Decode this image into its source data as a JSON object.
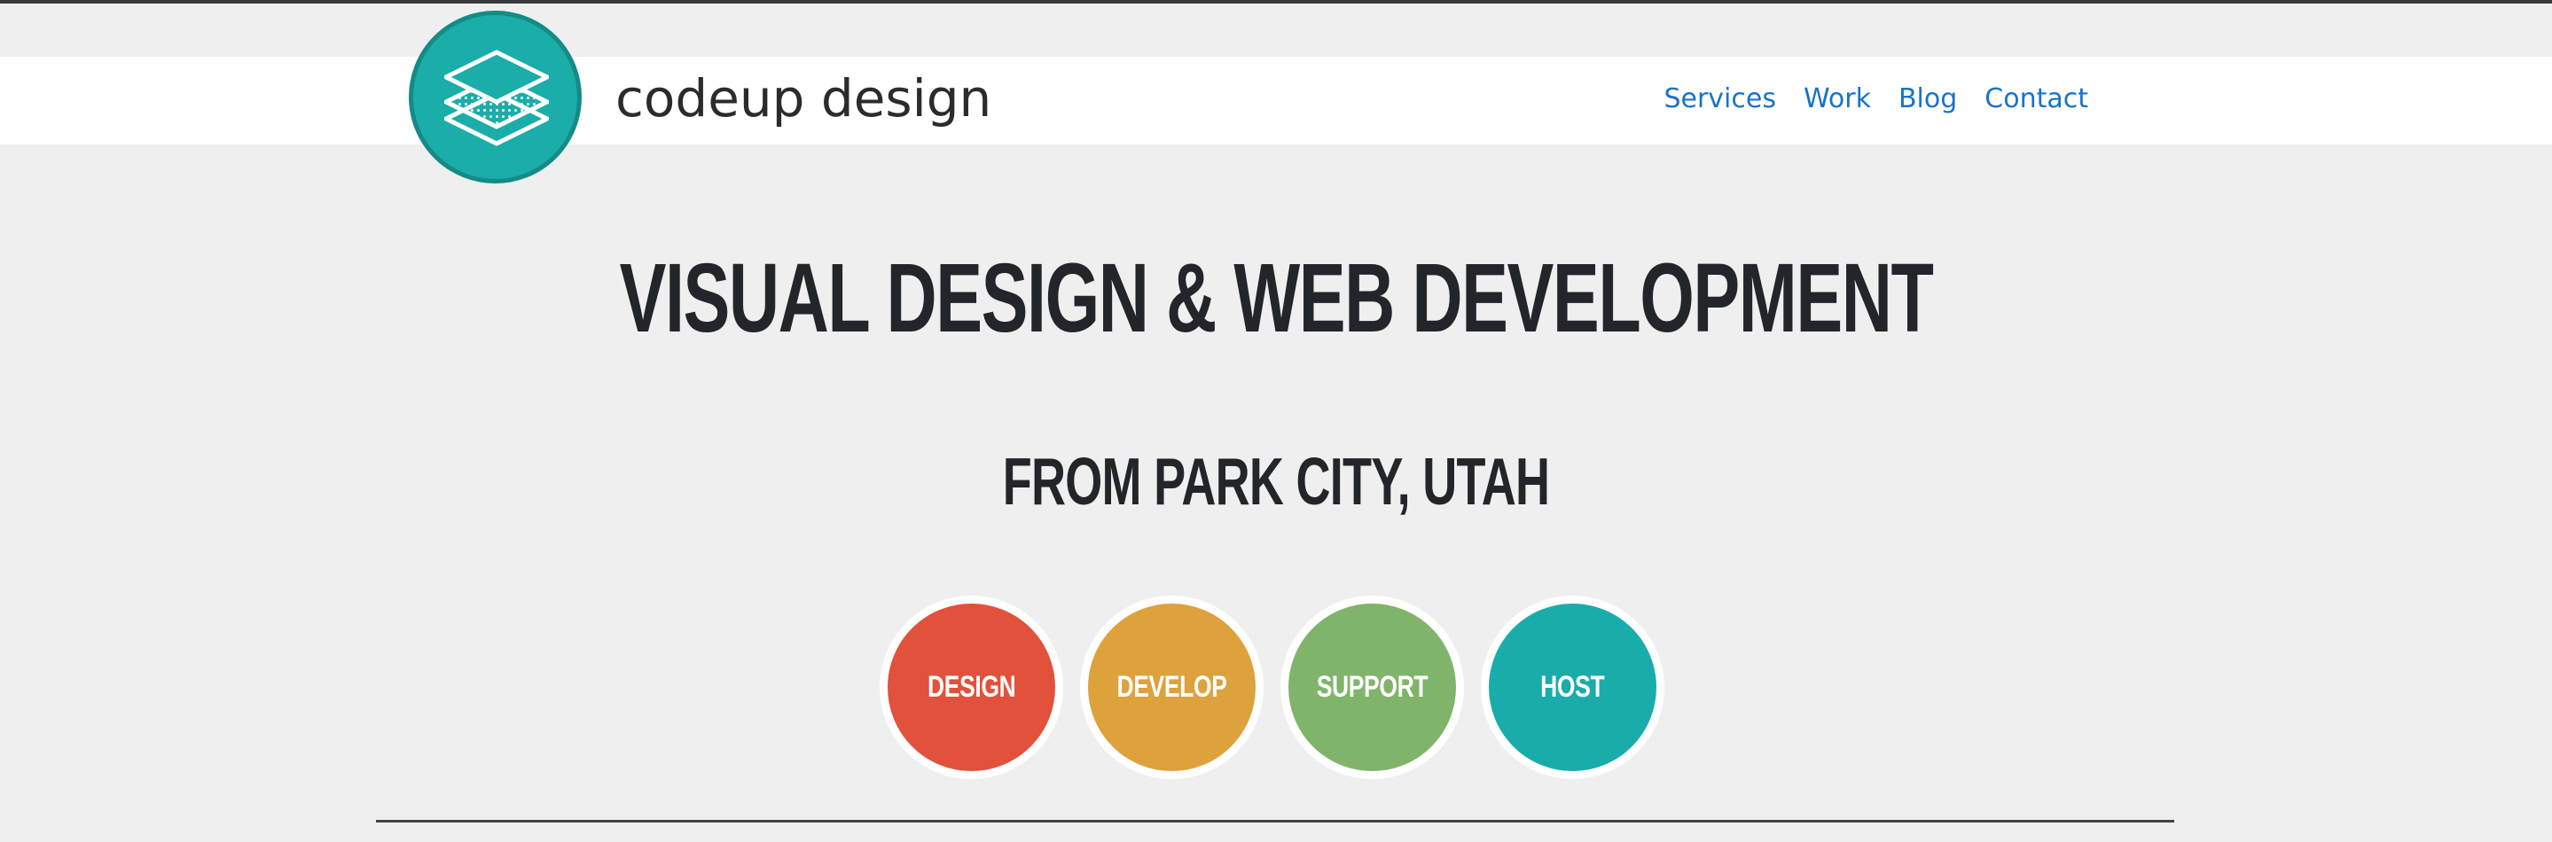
{
  "brand": {
    "name": "codeup design"
  },
  "nav": {
    "links": [
      "Services",
      "Work",
      "Blog",
      "Contact"
    ]
  },
  "hero": {
    "headline": "VISUAL DESIGN & WEB DEVELOPMENT",
    "subheadline": "FROM PARK CITY, UTAH"
  },
  "services": [
    {
      "label": "DESIGN",
      "color": "#e2513b"
    },
    {
      "label": "DEVELOP",
      "color": "#dda23c"
    },
    {
      "label": "SUPPORT",
      "color": "#80b46b"
    },
    {
      "label": "HOST",
      "color": "#1aacaa"
    }
  ],
  "colors": {
    "accent": "#1aada9",
    "link": "#1a73c8",
    "text": "#22252a",
    "background": "#efefef"
  }
}
